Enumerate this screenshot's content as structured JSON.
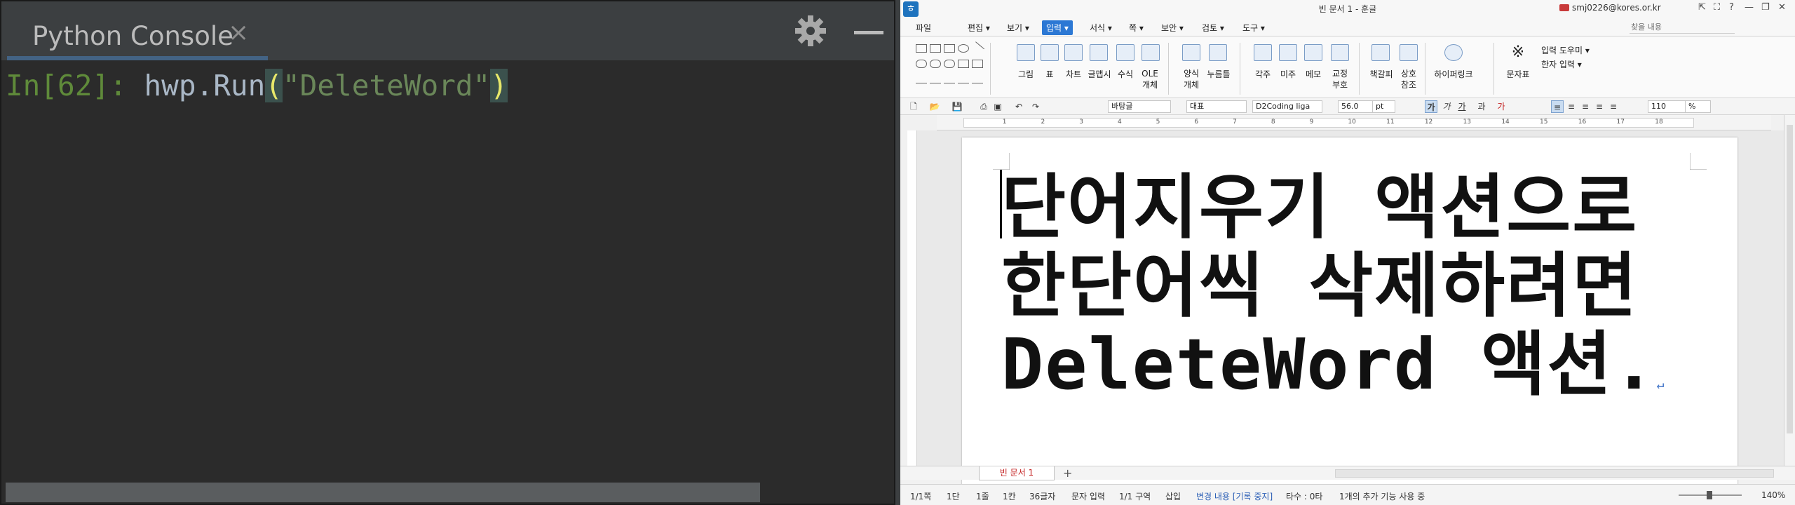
{
  "console": {
    "tab_title": "Python Console",
    "tab_close": "×",
    "prompt": "In[62]: ",
    "code_obj": "hwp.Run",
    "code_open": "(",
    "code_arg": "\"DeleteWord\"",
    "code_close": ")"
  },
  "hwp": {
    "title": "빈 문서 1 - 훈글",
    "user_email": "smj0226@kores.or.kr",
    "window_buttons": [
      "⇱",
      "⛶",
      "?",
      "—",
      "❐",
      "✕"
    ],
    "menu": [
      {
        "label": "파일"
      },
      {
        "label": "편집 ▾"
      },
      {
        "label": "보기 ▾"
      },
      {
        "label": "입력 ▾",
        "active": true
      },
      {
        "label": "서식 ▾"
      },
      {
        "label": "쪽 ▾"
      },
      {
        "label": "보안 ▾"
      },
      {
        "label": "검토 ▾"
      },
      {
        "label": "도구 ▾"
      }
    ],
    "search_placeholder": "찾을 내용",
    "ribbon": {
      "picture": "그림",
      "table": "표",
      "chart": "차트",
      "wordart": "글맵시",
      "formula": "수식",
      "ole": "OLE\n개체",
      "form_obj": "양식\n개체",
      "button": "누름틀",
      "footnote": "각주",
      "endnote": "미주",
      "memo": "메모",
      "proof": "교정\n부호",
      "bookmark": "책갈피",
      "crossref": "상호\n참조",
      "hyperlink": "하이퍼링크",
      "charmap": "문자표",
      "input_helper": "입력 도우미 ▾",
      "hanja_input": "한자 입력 ▾"
    },
    "format": {
      "style": "바탕글",
      "lang": "대표",
      "font": "D2Coding liga",
      "size": "56.0",
      "unit": "pt",
      "zoom": "110",
      "zoom_unit": "%"
    },
    "ruler_ticks": [
      "1",
      "2",
      "3",
      "4",
      "5",
      "6",
      "7",
      "8",
      "9",
      "10",
      "11",
      "12",
      "13",
      "14",
      "15",
      "16",
      "17",
      "18"
    ],
    "doc_lines": [
      "단어지우기 액션으로",
      "한단어씩 삭제하려면",
      "DeleteWord 액션."
    ],
    "doc_para_mark": "↵",
    "doc_tab": "빈 문서 1",
    "status": {
      "page": "1/1쪽",
      "col": "1단",
      "line": "1줄",
      "pos": "1칸",
      "chars": "36글자",
      "input": "문자 입력",
      "section": "1/1 구역",
      "insert": "삽입",
      "track": "변경 내용 [기록 중지]",
      "typo": "타수 : 0타",
      "extra": "1개의 추가 기능 사용 중",
      "zoom": "140%"
    }
  }
}
